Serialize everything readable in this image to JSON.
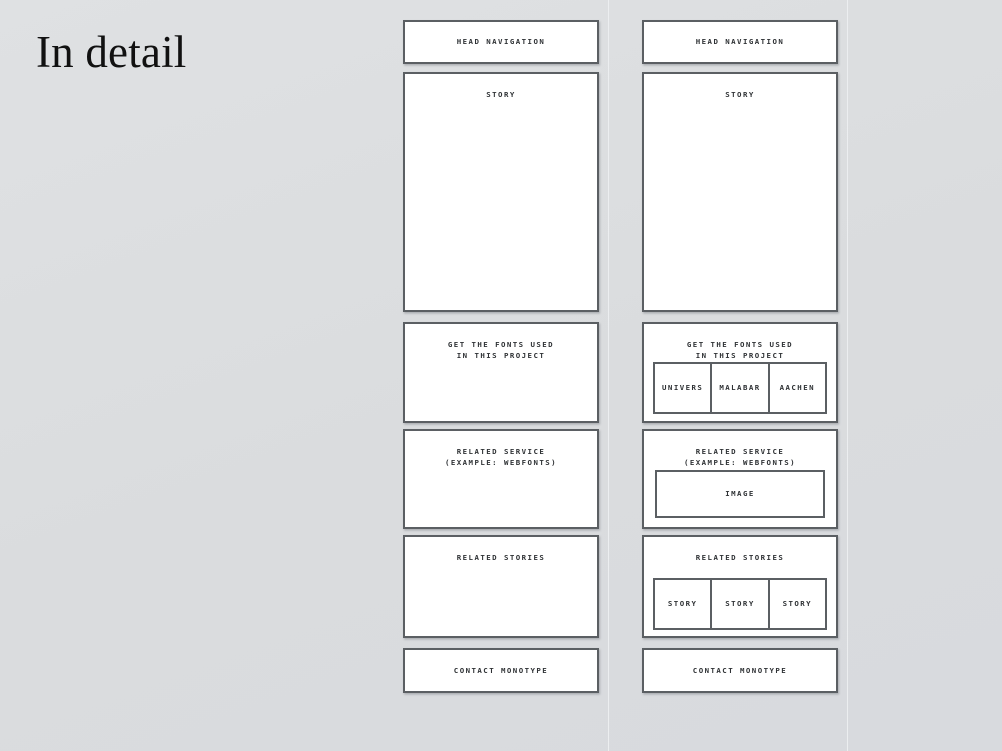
{
  "slide": {
    "title": "In detail",
    "background_color": "#dcdee0",
    "box_border_color": "#5b5f63",
    "box_fill_color": "#ffffff",
    "label_color": "#2f3235",
    "guide_color": "#eceef0"
  },
  "columns": [
    {
      "id": "simple",
      "sections": [
        {
          "id": "head-navigation",
          "label": "HEAD NAVIGATION"
        },
        {
          "id": "story",
          "label": "STORY"
        },
        {
          "id": "fonts",
          "label": "GET THE FONTS USED\nIN THIS PROJECT"
        },
        {
          "id": "service",
          "label": "RELATED SERVICE\n(EXAMPLE: WEBFONTS)"
        },
        {
          "id": "related-stories",
          "label": "RELATED STORIES"
        },
        {
          "id": "contact",
          "label": "CONTACT MONOTYPE"
        }
      ]
    },
    {
      "id": "detailed",
      "sections": [
        {
          "id": "head-navigation",
          "label": "HEAD NAVIGATION"
        },
        {
          "id": "story",
          "label": "STORY"
        },
        {
          "id": "fonts",
          "label": "GET THE FONTS USED\nIN THIS PROJECT",
          "cells": [
            "UNIVERS",
            "MALABAR",
            "AACHEN"
          ]
        },
        {
          "id": "service",
          "label": "RELATED SERVICE\n(EXAMPLE: WEBFONTS)",
          "image_label": "IMAGE"
        },
        {
          "id": "related-stories",
          "label": "RELATED STORIES",
          "cells": [
            "STORY",
            "STORY",
            "STORY"
          ]
        },
        {
          "id": "contact",
          "label": "CONTACT MONOTYPE"
        }
      ]
    }
  ]
}
